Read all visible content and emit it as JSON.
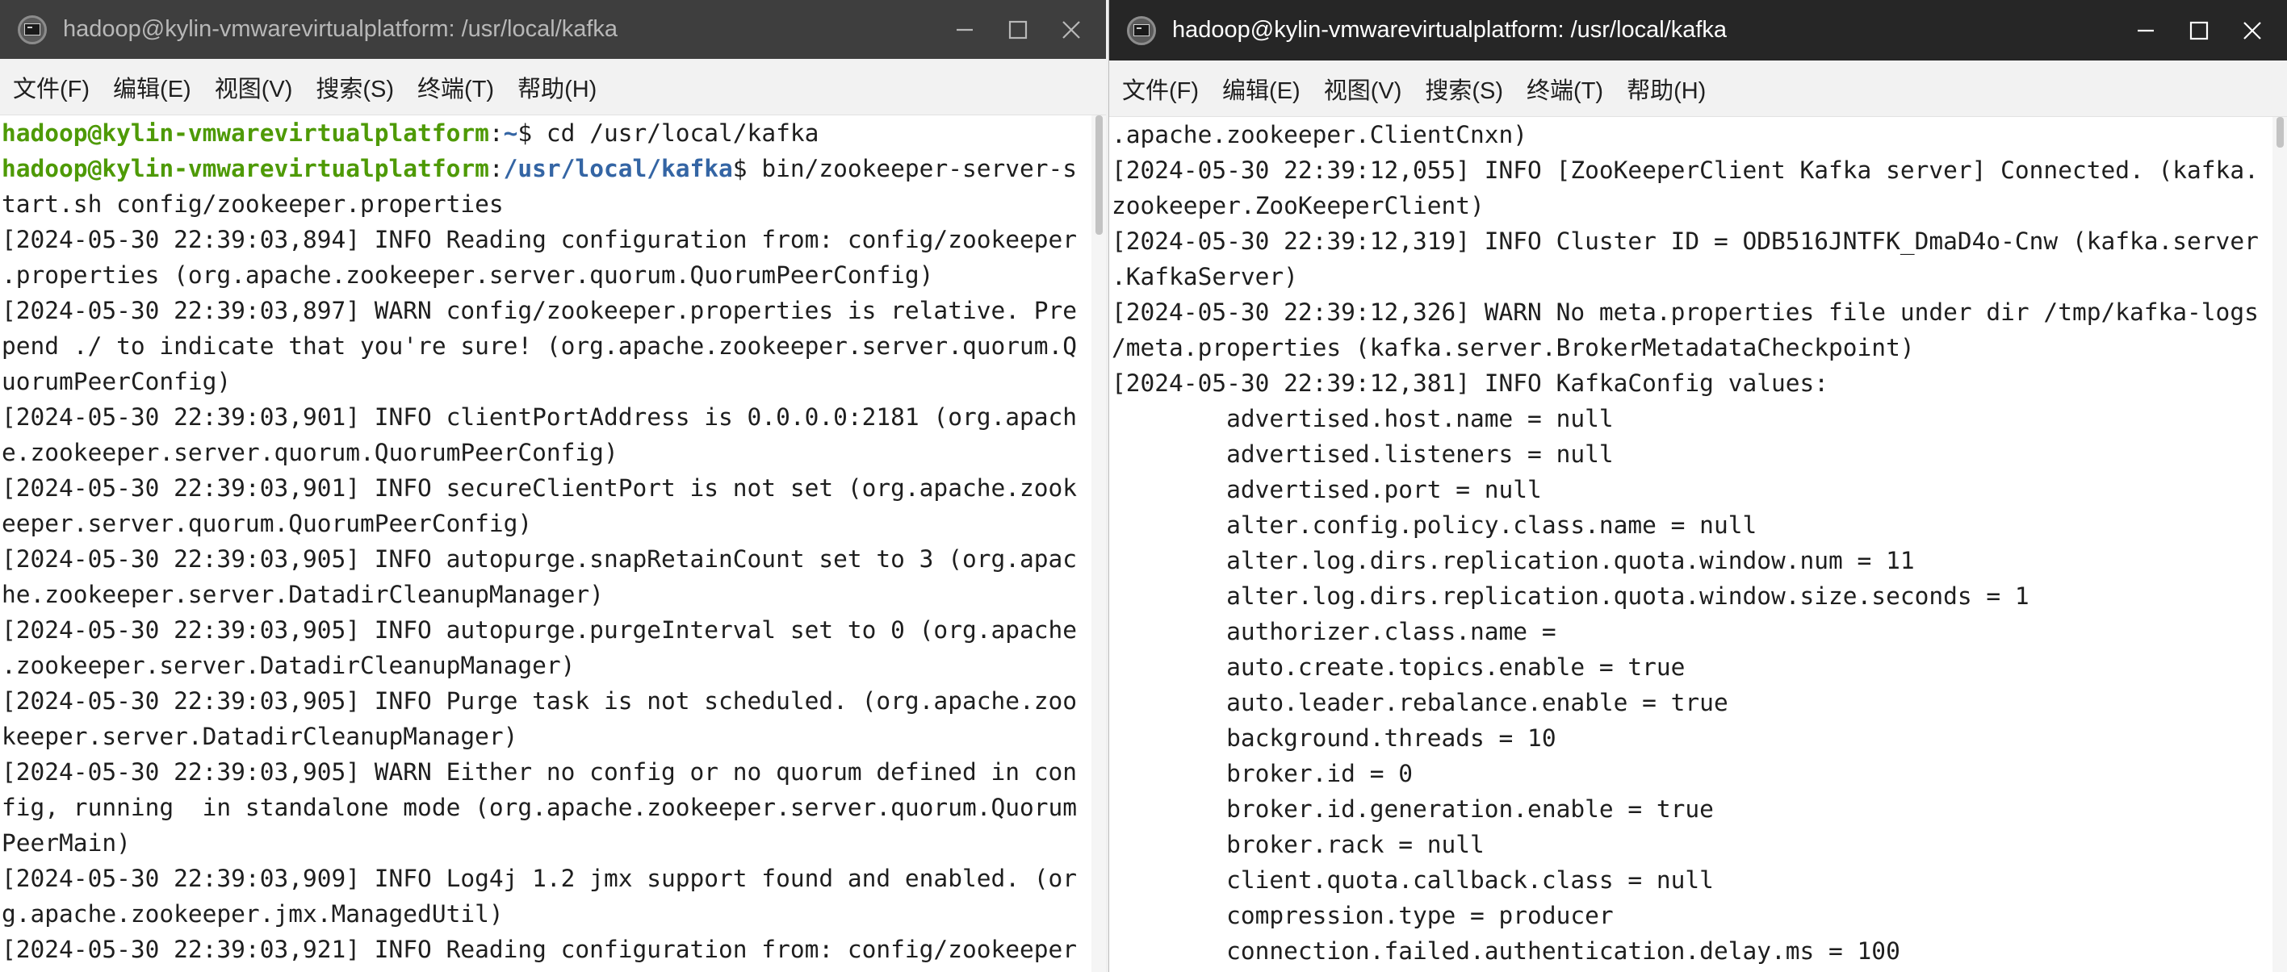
{
  "colors": {
    "prompt_user": "#4e9a06",
    "prompt_path": "#3465a4",
    "terminal_text": "#1e1e1e",
    "titlebar_inactive": "#3e3e3e",
    "titlebar_active": "#262626"
  },
  "left": {
    "title": "hadoop@kylin-vmwarevirtualplatform: /usr/local/kafka",
    "menu": [
      "文件(F)",
      "编辑(E)",
      "视图(V)",
      "搜索(S)",
      "终端(T)",
      "帮助(H)"
    ],
    "prompt1": {
      "user": "hadoop@kylin-vmwarevirtualplatform",
      "sep": ":",
      "path": "~",
      "cmd": "$ cd /usr/local/kafka"
    },
    "prompt2": {
      "user": "hadoop@kylin-vmwarevirtualplatform",
      "sep": ":",
      "path": "/usr/local/kafka",
      "cmd": "$ bin/zookeeper-server-s"
    },
    "lines": [
      "tart.sh config/zookeeper.properties",
      "[2024-05-30 22:39:03,894] INFO Reading configuration from: config/zookeeper",
      ".properties (org.apache.zookeeper.server.quorum.QuorumPeerConfig)",
      "[2024-05-30 22:39:03,897] WARN config/zookeeper.properties is relative. Pre",
      "pend ./ to indicate that you're sure! (org.apache.zookeeper.server.quorum.Q",
      "uorumPeerConfig)",
      "[2024-05-30 22:39:03,901] INFO clientPortAddress is 0.0.0.0:2181 (org.apach",
      "e.zookeeper.server.quorum.QuorumPeerConfig)",
      "[2024-05-30 22:39:03,901] INFO secureClientPort is not set (org.apache.zook",
      "eeper.server.quorum.QuorumPeerConfig)",
      "[2024-05-30 22:39:03,905] INFO autopurge.snapRetainCount set to 3 (org.apac",
      "he.zookeeper.server.DatadirCleanupManager)",
      "[2024-05-30 22:39:03,905] INFO autopurge.purgeInterval set to 0 (org.apache",
      ".zookeeper.server.DatadirCleanupManager)",
      "[2024-05-30 22:39:03,905] INFO Purge task is not scheduled. (org.apache.zoo",
      "keeper.server.DatadirCleanupManager)",
      "[2024-05-30 22:39:03,905] WARN Either no config or no quorum defined in con",
      "fig, running  in standalone mode (org.apache.zookeeper.server.quorum.Quorum",
      "PeerMain)",
      "[2024-05-30 22:39:03,909] INFO Log4j 1.2 jmx support found and enabled. (or",
      "g.apache.zookeeper.jmx.ManagedUtil)",
      "[2024-05-30 22:39:03,921] INFO Reading configuration from: config/zookeeper"
    ]
  },
  "right": {
    "title": "hadoop@kylin-vmwarevirtualplatform: /usr/local/kafka",
    "menu": [
      "文件(F)",
      "编辑(E)",
      "视图(V)",
      "搜索(S)",
      "终端(T)",
      "帮助(H)"
    ],
    "lines": [
      ".apache.zookeeper.ClientCnxn)",
      "[2024-05-30 22:39:12,055] INFO [ZooKeeperClient Kafka server] Connected. (kafka.",
      "zookeeper.ZooKeeperClient)",
      "[2024-05-30 22:39:12,319] INFO Cluster ID = ODB516JNTFK_DmaD4o-Cnw (kafka.server",
      ".KafkaServer)",
      "[2024-05-30 22:39:12,326] WARN No meta.properties file under dir /tmp/kafka-logs",
      "/meta.properties (kafka.server.BrokerMetadataCheckpoint)",
      "[2024-05-30 22:39:12,381] INFO KafkaConfig values:",
      "        advertised.host.name = null",
      "        advertised.listeners = null",
      "        advertised.port = null",
      "        alter.config.policy.class.name = null",
      "        alter.log.dirs.replication.quota.window.num = 11",
      "        alter.log.dirs.replication.quota.window.size.seconds = 1",
      "        authorizer.class.name =",
      "        auto.create.topics.enable = true",
      "        auto.leader.rebalance.enable = true",
      "        background.threads = 10",
      "        broker.id = 0",
      "        broker.id.generation.enable = true",
      "        broker.rack = null",
      "        client.quota.callback.class = null",
      "        compression.type = producer",
      "        connection.failed.authentication.delay.ms = 100"
    ]
  }
}
